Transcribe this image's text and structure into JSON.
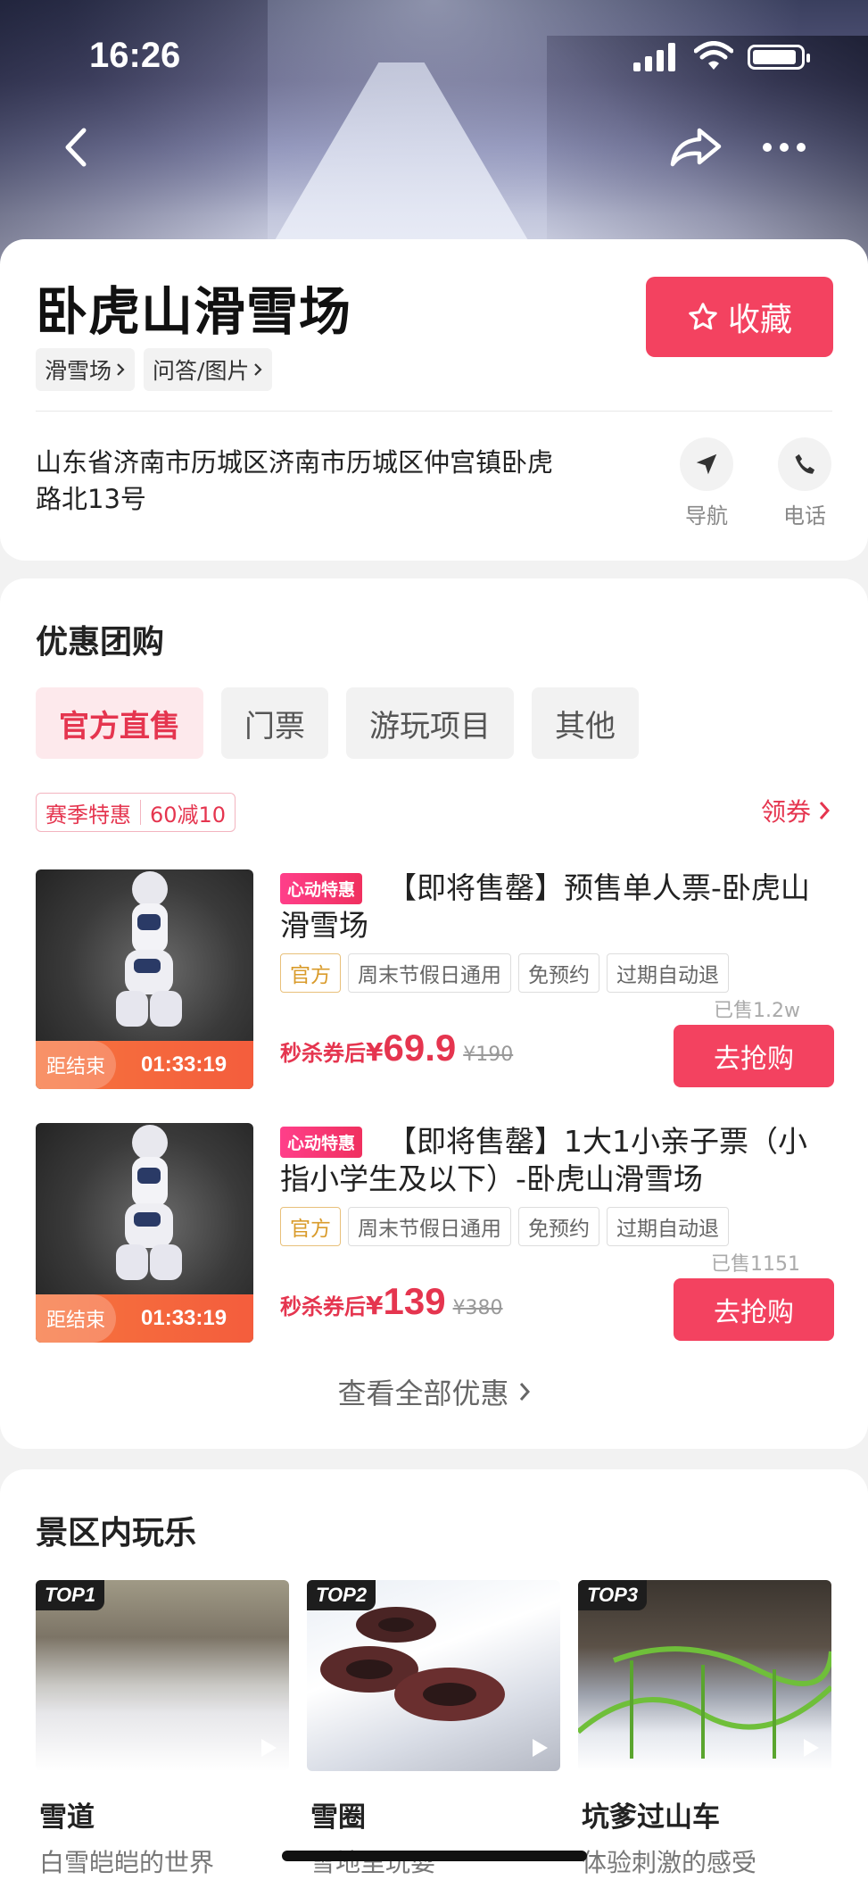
{
  "status_bar": {
    "time": "16:26"
  },
  "header": {
    "title": "卧虎山滑雪场",
    "favorite_label": "收藏"
  },
  "tags": [
    "滑雪场",
    "问答/图片"
  ],
  "address": "山东省济南市历城区济南市历城区仲宫镇卧虎路北13号",
  "actions": {
    "navigate": "导航",
    "call": "电话"
  },
  "deals_section": {
    "title": "优惠团购",
    "tabs": [
      "官方直售",
      "门票",
      "游玩项目",
      "其他"
    ],
    "coupon": {
      "name": "赛季特惠",
      "value": "60减10",
      "get_label": "领券"
    },
    "items": [
      {
        "badge": "心动特惠",
        "name": "【即将售罄】预售单人票-卧虎山滑雪场",
        "labels": [
          "官方",
          "周末节假日通用",
          "免预约",
          "过期自动退"
        ],
        "sold": "已售1.2w",
        "price_prefix": "秒杀券后",
        "currency": "¥",
        "price": "69.9",
        "original_price": "¥190",
        "countdown_label": "距结束",
        "countdown": "01:33:19",
        "buy_label": "去抢购"
      },
      {
        "badge": "心动特惠",
        "name": "【即将售罄】1大1小亲子票（小指小学生及以下）-卧虎山滑雪场",
        "labels": [
          "官方",
          "周末节假日通用",
          "免预约",
          "过期自动退"
        ],
        "sold": "已售1151",
        "price_prefix": "秒杀券后",
        "currency": "¥",
        "price": "139",
        "original_price": "¥380",
        "countdown_label": "距结束",
        "countdown": "01:33:19",
        "buy_label": "去抢购"
      }
    ],
    "view_all": "查看全部优惠"
  },
  "fun_section": {
    "title": "景区内玩乐",
    "items": [
      {
        "rank": "TOP1",
        "name": "雪道",
        "desc": "白雪皑皑的世界"
      },
      {
        "rank": "TOP2",
        "name": "雪圈",
        "desc": "雪地里玩耍"
      },
      {
        "rank": "TOP3",
        "name": "坑爹过山车",
        "desc": "体验刺激的感受"
      }
    ]
  },
  "colors": {
    "accent": "#f34260",
    "accent_light": "#fde9ec",
    "official_tag": "#d99b2b"
  }
}
